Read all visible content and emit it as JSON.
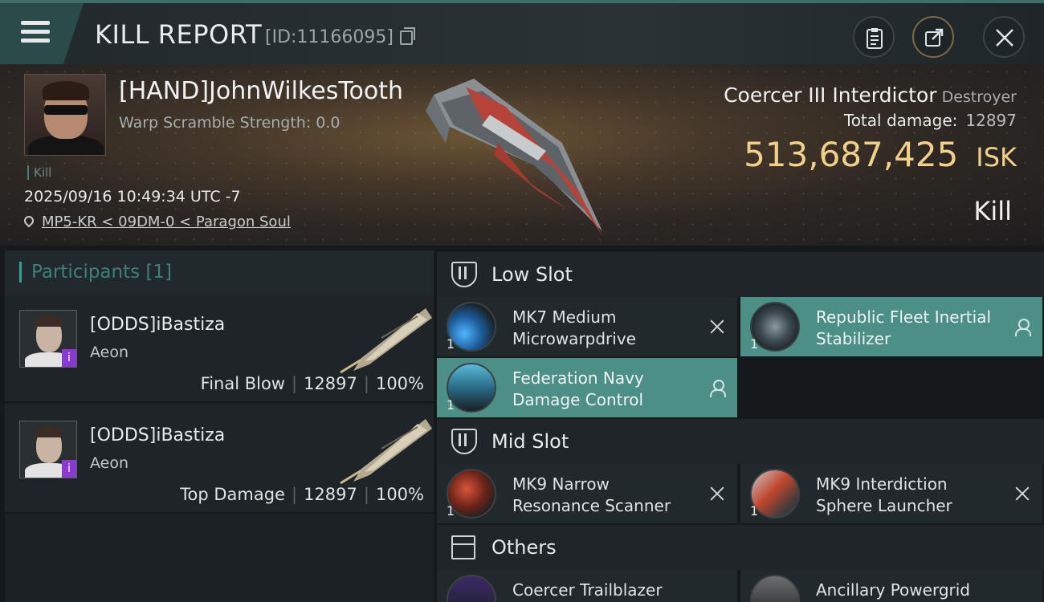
{
  "header": {
    "title": "KILL REPORT",
    "report_id": "[ID:11166095]"
  },
  "victim": {
    "name": "[HAND]JohnWilkesTooth",
    "warp_scramble": "Warp Scramble Strength: 0.0",
    "tag": "Kill",
    "timestamp": "2025/09/16 10:49:34 UTC -7",
    "location": "MP5-KR < 09DM-0 < Paragon Soul",
    "ship_name": "Coercer III Interdictor",
    "ship_class": "Destroyer",
    "total_damage_label": "Total damage:",
    "total_damage": "12897",
    "isk_value": "513,687,425",
    "isk_unit": "ISK",
    "outcome": "Kill"
  },
  "participants": {
    "title": "Participants [1]",
    "rows": [
      {
        "name": "[ODDS]iBastiza",
        "ship": "Aeon",
        "role": "Final Blow",
        "damage": "12897",
        "percent": "100%"
      },
      {
        "name": "[ODDS]iBastiza",
        "ship": "Aeon",
        "role": "Top Damage",
        "damage": "12897",
        "percent": "100%"
      }
    ]
  },
  "slots": {
    "low": {
      "title": "Low Slot",
      "items": [
        {
          "name": "MK7 Medium Microwarpdrive",
          "qty": "1",
          "status": "destroyed"
        },
        {
          "name": "Republic Fleet Inertial Stabilizer",
          "qty": "1",
          "status": "dropped"
        },
        {
          "name": "Federation Navy Damage Control",
          "qty": "1",
          "status": "dropped"
        }
      ]
    },
    "mid": {
      "title": "Mid Slot",
      "items": [
        {
          "name": "MK9 Narrow Resonance Scanner",
          "qty": "1",
          "status": "destroyed"
        },
        {
          "name": "MK9 Interdiction Sphere Launcher",
          "qty": "1",
          "status": "destroyed"
        }
      ]
    },
    "others": {
      "title": "Others",
      "items": [
        {
          "name": "Coercer Trailblazer"
        },
        {
          "name": "Ancillary Powergrid"
        }
      ]
    }
  },
  "colors": {
    "accent_teal": "#3f9c94",
    "dropped_bg": "#4c8f86",
    "isk_gold": "#f2d089"
  },
  "icons": {
    "menu": "hamburger-icon",
    "copy": "copy-icon",
    "clipboard": "clipboard-icon",
    "share": "share-icon",
    "close": "close-icon",
    "location": "map-pin-icon",
    "destroyed": "destroyed-x-icon",
    "dropped": "person-icon"
  }
}
